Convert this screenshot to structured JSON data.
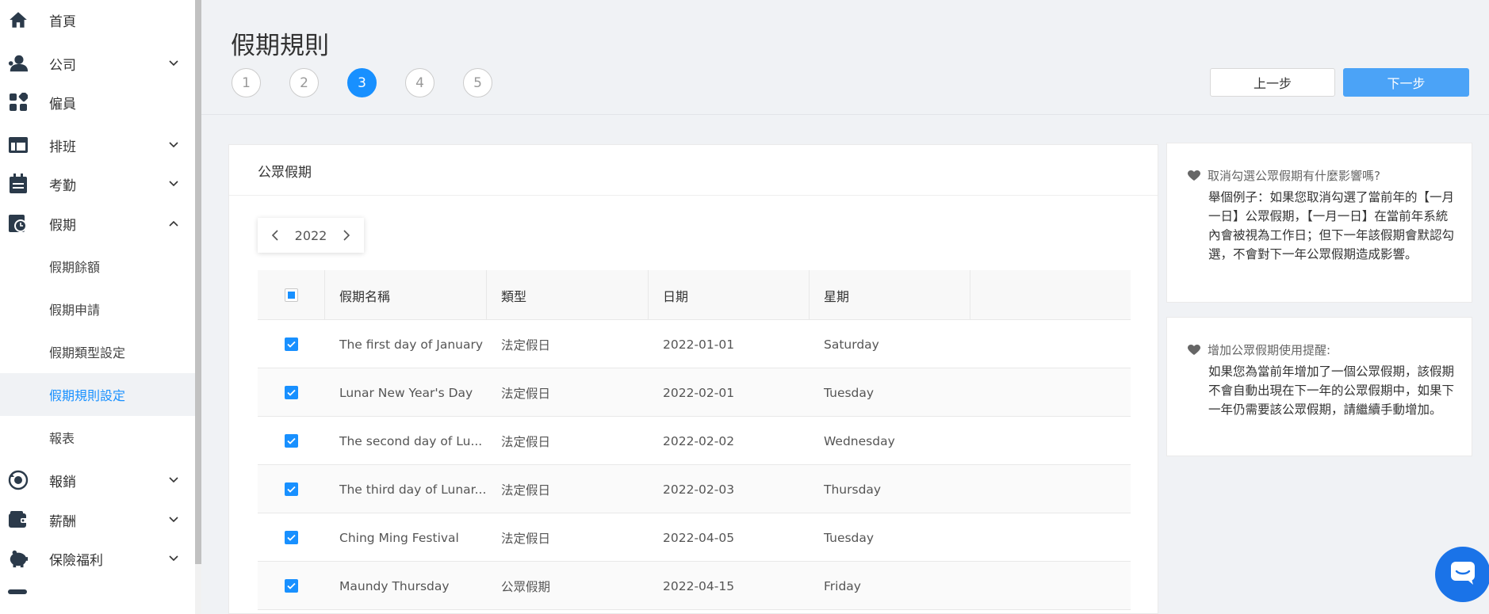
{
  "sidebar": {
    "items": [
      {
        "label": "首頁",
        "icon": "home-icon",
        "expandable": false
      },
      {
        "label": "公司",
        "icon": "company-icon",
        "expandable": true
      },
      {
        "label": "僱員",
        "icon": "employee-icon",
        "expandable": false
      },
      {
        "label": "排班",
        "icon": "schedule-icon",
        "expandable": true
      },
      {
        "label": "考勤",
        "icon": "attendance-icon",
        "expandable": true
      },
      {
        "label": "假期",
        "icon": "leave-icon",
        "expandable": true,
        "expanded": true
      }
    ],
    "sub_items": [
      "假期餘額",
      "假期申請",
      "假期類型設定",
      "假期規則設定"
    ],
    "active_sub": "假期規則設定",
    "items_after": [
      {
        "label": "報表",
        "icon": "",
        "expandable": false
      },
      {
        "label": "報銷",
        "icon": "reimburse-icon",
        "expandable": true
      },
      {
        "label": "薪酬",
        "icon": "wallet-icon",
        "expandable": true
      },
      {
        "label": "保險福利",
        "icon": "piggy-bank-icon",
        "expandable": true
      }
    ]
  },
  "header": {
    "title": "假期規則",
    "steps": [
      "1",
      "2",
      "3",
      "4",
      "5"
    ],
    "active_step": 3,
    "prev_label": "上一步",
    "next_label": "下一步"
  },
  "holidays": {
    "title": "公眾假期",
    "year": "2022",
    "columns": [
      "假期名稱",
      "類型",
      "日期",
      "星期"
    ],
    "rows": [
      {
        "name": "The first day of January",
        "type": "法定假日",
        "date": "2022-01-01",
        "weekday": "Saturday",
        "checked": true
      },
      {
        "name": "Lunar New Year's Day",
        "type": "法定假日",
        "date": "2022-02-01",
        "weekday": "Tuesday",
        "checked": true
      },
      {
        "name": "The second day of Lu...",
        "type": "法定假日",
        "date": "2022-02-02",
        "weekday": "Wednesday",
        "checked": true
      },
      {
        "name": "The third day of Lunar...",
        "type": "法定假日",
        "date": "2022-02-03",
        "weekday": "Thursday",
        "checked": true
      },
      {
        "name": "Ching Ming Festival",
        "type": "法定假日",
        "date": "2022-04-05",
        "weekday": "Tuesday",
        "checked": true
      },
      {
        "name": "Maundy Thursday",
        "type": "公眾假期",
        "date": "2022-04-15",
        "weekday": "Friday",
        "checked": true
      }
    ]
  },
  "info": {
    "q1": "取消勾選公眾假期有什麼影響嗎?",
    "a1": "舉個例子：如果您取消勾選了當前年的【一月一日】公眾假期，【一月一日】在當前年系統內會被視為工作日；但下一年該假期會默認勾選，不會對下一年公眾假期造成影響。",
    "q2": "增加公眾假期使用提醒:",
    "a2": "如果您為當前年增加了一個公眾假期，該假期不會自動出現在下一年的公眾假期中，如果下一年仍需要該公眾假期，請繼續手動增加。"
  },
  "colors": {
    "accent": "#1890ff",
    "next_button": "#4ba3f7",
    "chat": "#1a73e8"
  }
}
